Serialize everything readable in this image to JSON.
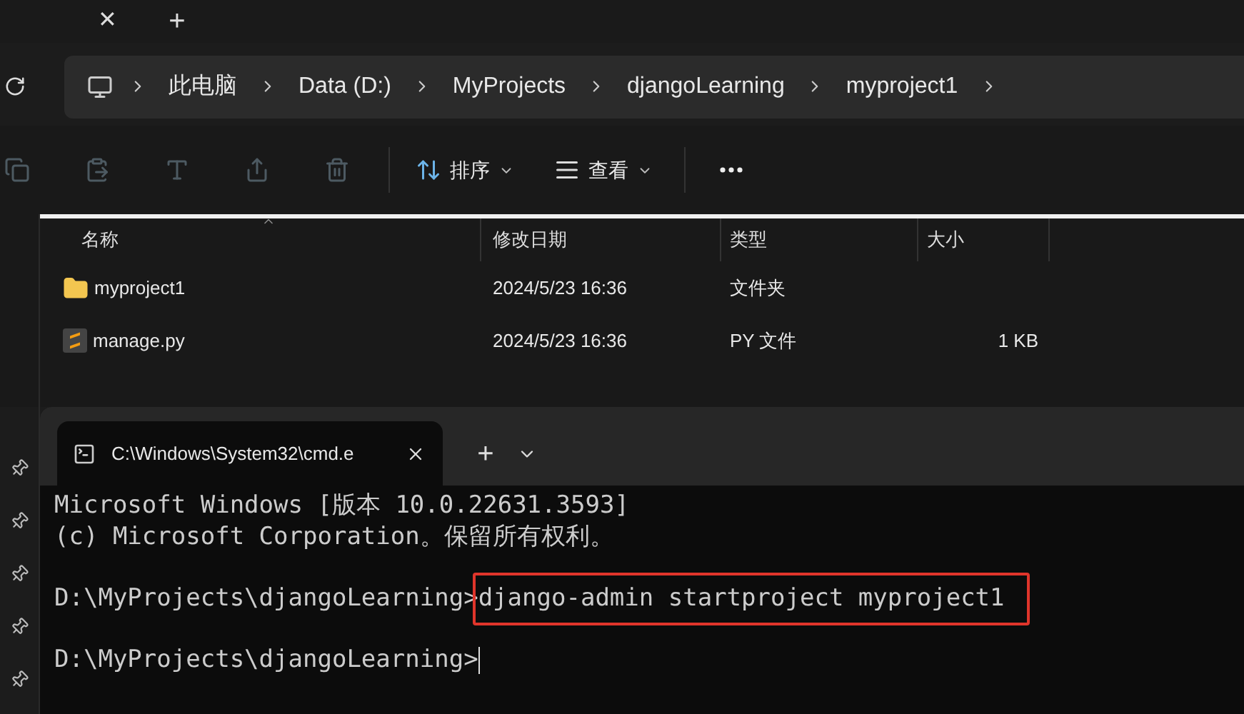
{
  "window_tabs": {
    "close": "✕",
    "new_tab": "+"
  },
  "address_bar": {
    "crumbs": [
      "此电脑",
      "Data (D:)",
      "MyProjects",
      "djangoLearning",
      "myproject1"
    ]
  },
  "toolbar": {
    "icon_buttons": [
      {
        "kind": "copy",
        "disabled": true
      },
      {
        "kind": "paste",
        "disabled": true
      },
      {
        "kind": "rename",
        "disabled": true
      },
      {
        "kind": "share",
        "disabled": true
      },
      {
        "kind": "delete",
        "disabled": true
      }
    ],
    "menus": [
      {
        "kind": "sort",
        "label": "排序"
      },
      {
        "kind": "view",
        "label": "查看"
      }
    ]
  },
  "file_list": {
    "columns": [
      {
        "label": "名称",
        "sorted": true
      },
      {
        "label": "修改日期",
        "sorted": false
      },
      {
        "label": "类型",
        "sorted": false
      },
      {
        "label": "大小",
        "sorted": false
      }
    ],
    "rows": [
      {
        "kind": "folder",
        "name": "myproject1",
        "modified": "2024/5/23 16:36",
        "type": "文件夹"
      },
      {
        "kind": "python",
        "name": "manage.py",
        "modified": "2024/5/23 16:36",
        "type": "PY 文件",
        "size": "1 KB"
      }
    ]
  },
  "terminal": {
    "tab_title": "C:\\Windows\\System32\\cmd.e",
    "new_tab": "+",
    "lines": [
      {
        "kind": "output",
        "text": "Microsoft Windows [版本 10.0.22631.3593]"
      },
      {
        "kind": "output",
        "text": "(c) Microsoft Corporation。保留所有权利。"
      },
      {
        "kind": "blank"
      },
      {
        "kind": "prompt",
        "prompt": "D:\\MyProjects\\djangoLearning>",
        "command": "django-admin startproject myproject1",
        "highlighted": true,
        "cursor": false
      },
      {
        "kind": "blank"
      },
      {
        "kind": "prompt",
        "prompt": "D:\\MyProjects\\djangoLearning>",
        "highlighted": false,
        "cursor": true
      }
    ]
  }
}
